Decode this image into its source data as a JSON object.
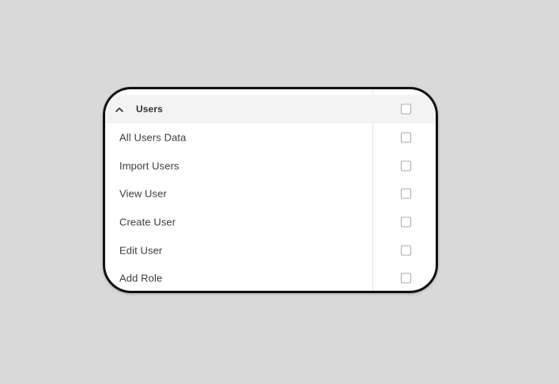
{
  "permissions": {
    "group": {
      "label": "Users",
      "icon": "chevron-up-icon",
      "expanded": true,
      "checked": false
    },
    "items": [
      {
        "label": "All Users Data",
        "checked": false
      },
      {
        "label": "Import Users",
        "checked": false
      },
      {
        "label": "View User",
        "checked": false
      },
      {
        "label": "Create User",
        "checked": false
      },
      {
        "label": "Edit User",
        "checked": false
      },
      {
        "label": "Add Role",
        "checked": false
      }
    ]
  }
}
